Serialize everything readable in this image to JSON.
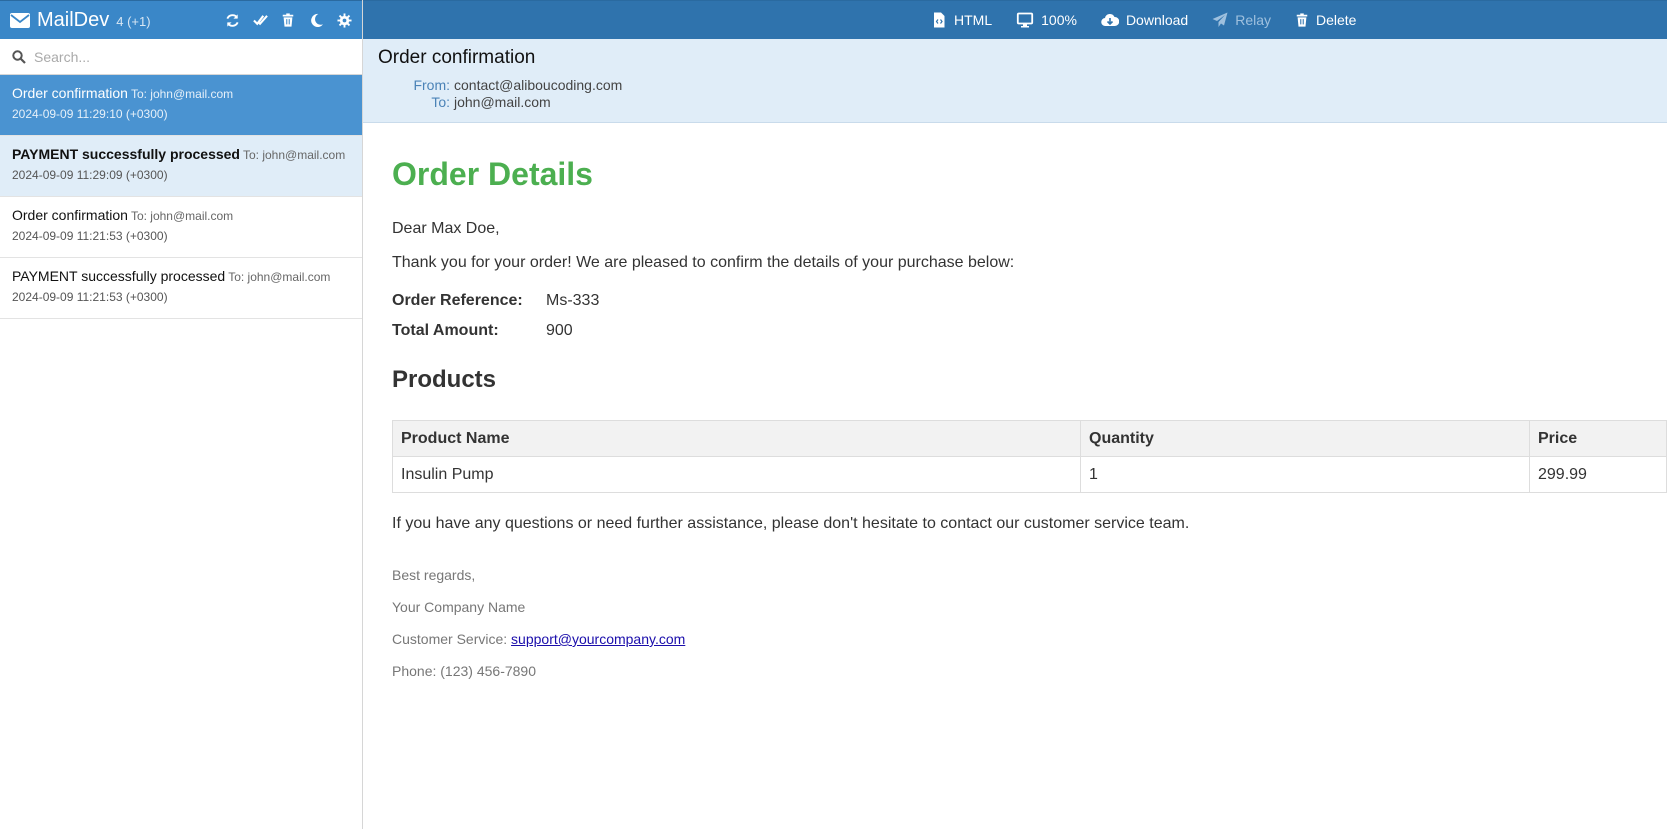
{
  "app": {
    "name": "MailDev",
    "count": "4 (+1)"
  },
  "search": {
    "placeholder": "Search..."
  },
  "messages": [
    {
      "subject": "Order confirmation",
      "to": "To: john@mail.com",
      "date": "2024-09-09 11:29:10 (+0300)"
    },
    {
      "subject": "PAYMENT successfully processed",
      "to": "To: john@mail.com",
      "date": "2024-09-09 11:29:09 (+0300)"
    },
    {
      "subject": "Order confirmation",
      "to": "To: john@mail.com",
      "date": "2024-09-09 11:21:53 (+0300)"
    },
    {
      "subject": "PAYMENT successfully processed",
      "to": "To: john@mail.com",
      "date": "2024-09-09 11:21:53 (+0300)"
    }
  ],
  "toolbar": {
    "html_label": "HTML",
    "zoom_label": "100%",
    "download_label": "Download",
    "relay_label": "Relay",
    "delete_label": "Delete"
  },
  "email": {
    "subject": "Order confirmation",
    "from_label": "From:",
    "from": "contact@aliboucoding.com",
    "to_label": "To:",
    "to": "john@mail.com",
    "heading": "Order Details",
    "greeting": "Dear Max Doe,",
    "intro": "Thank you for your order! We are pleased to confirm the details of your purchase below:",
    "order_ref_label": "Order Reference:",
    "order_ref": "Ms-333",
    "total_label": "Total Amount:",
    "total": "900",
    "products_heading": "Products",
    "table": {
      "headers": [
        "Product Name",
        "Quantity",
        "Price"
      ],
      "rows": [
        [
          "Insulin Pump",
          "1",
          "299.99"
        ]
      ]
    },
    "closing": "If you have any questions or need further assistance, please don't hesitate to contact our customer service team.",
    "regards": "Best regards,",
    "company": "Your Company Name",
    "service_label": "Customer Service:",
    "service_email": "support@yourcompany.com",
    "phone": "Phone: (123) 456-7890"
  },
  "colors": {
    "brand_bar": "#3a87c8",
    "toolbar": "#2f73ad",
    "selected": "#4a93d1",
    "heading_green": "#4caf50"
  },
  "icons": [
    "envelope-icon",
    "refresh-icon",
    "mark-all-read-icon",
    "trash-icon",
    "moon-icon",
    "gear-icon",
    "search-icon",
    "file-code-icon",
    "monitor-icon",
    "cloud-download-icon",
    "paper-plane-icon"
  ]
}
